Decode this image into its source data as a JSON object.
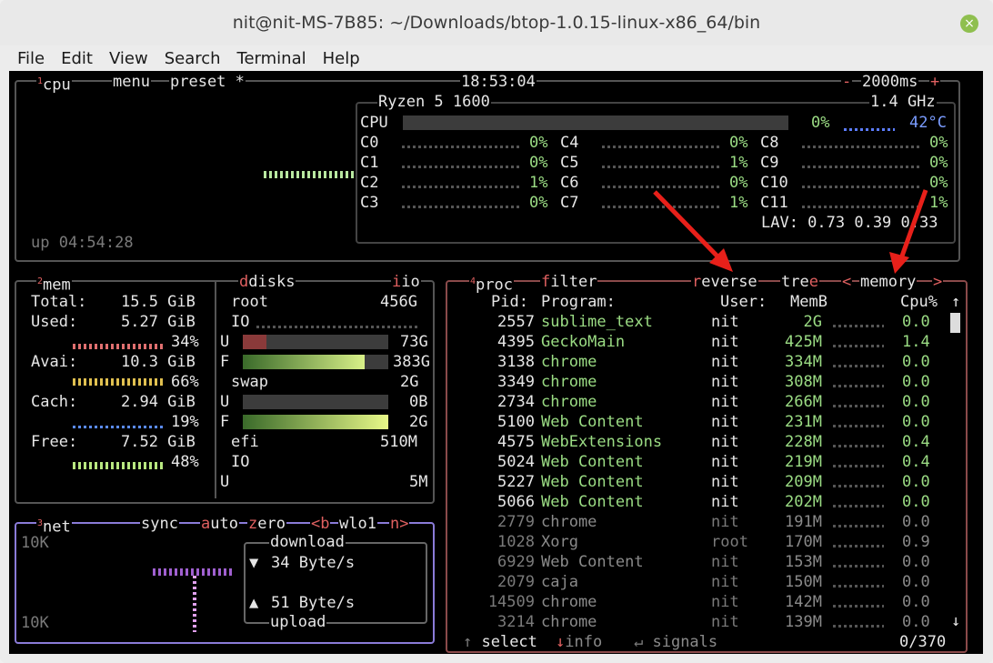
{
  "window": {
    "title": "nit@nit-MS-7B85: ~/Downloads/btop-1.0.15-linux-x86_64/bin",
    "close_label": "×"
  },
  "menu": [
    "File",
    "Edit",
    "View",
    "Search",
    "Terminal",
    "Help"
  ],
  "cpu_box": {
    "num": "1",
    "label": "cpu",
    "menu": "menu",
    "preset": "preset *",
    "clock": "18:53:04",
    "interval": "2000ms",
    "minus": "-",
    "plus": "+",
    "uptime": "up 04:54:28"
  },
  "cpu_info": {
    "model": "Ryzen 5 1600",
    "freq": "1.4 GHz",
    "total_label": "CPU",
    "total_pct": "0%",
    "temp": "42°C",
    "lav": "LAV: 0.73 0.39 0.33",
    "cores": [
      {
        "name": "C0",
        "pct": "0%"
      },
      {
        "name": "C1",
        "pct": "0%"
      },
      {
        "name": "C2",
        "pct": "1%"
      },
      {
        "name": "C3",
        "pct": "0%"
      },
      {
        "name": "C4",
        "pct": "0%"
      },
      {
        "name": "C5",
        "pct": "1%"
      },
      {
        "name": "C6",
        "pct": "0%"
      },
      {
        "name": "C7",
        "pct": "1%"
      },
      {
        "name": "C8",
        "pct": "0%"
      },
      {
        "name": "C9",
        "pct": "0%"
      },
      {
        "name": "C10",
        "pct": "0%"
      },
      {
        "name": "C11",
        "pct": "1%"
      }
    ]
  },
  "mem_box": {
    "num": "2",
    "label": "mem",
    "total": {
      "label": "Total:",
      "value": "15.5 GiB"
    },
    "used": {
      "label": "Used:",
      "value": "5.27 GiB",
      "pct": "34%"
    },
    "avail": {
      "label": "Avai:",
      "value": "10.3 GiB",
      "pct": "66%"
    },
    "cache": {
      "label": "Cach:",
      "value": "2.94 GiB",
      "pct": "19%"
    },
    "free": {
      "label": "Free:",
      "value": "7.52 GiB",
      "pct": "48%"
    }
  },
  "disks_box": {
    "label": "disks",
    "io": "io",
    "root": {
      "name": "root",
      "size": "456G",
      "io": "IO",
      "u": "U",
      "u_val": "73G",
      "f": "F",
      "f_val": "383G",
      "u_frac": 0.16,
      "f_frac": 0.84
    },
    "swap": {
      "name": "swap",
      "size": "2G",
      "u": "U",
      "u_val": "0B",
      "f": "F",
      "f_val": "2G",
      "u_frac": 0.0,
      "f_frac": 1.0
    },
    "efi": {
      "name": "efi",
      "size": "510M",
      "io": "IO",
      "u": "U",
      "u_val": "5M"
    }
  },
  "net_box": {
    "num": "3",
    "label": "net",
    "sync": "sync",
    "auto": "auto",
    "zero": "zero",
    "iface_prev": "<b",
    "iface": "wlo1",
    "iface_next": "n>",
    "scale_top": "10K",
    "scale_bottom": "10K",
    "download_label": "download",
    "download": "34 Byte/s",
    "upload": "51 Byte/s",
    "upload_label": "upload"
  },
  "proc_box": {
    "num": "4",
    "label": "proc",
    "filter": "filter",
    "reverse": "reverse",
    "tree": "tree",
    "sort": "memory",
    "sort_prev": "<",
    "sort_next": ">",
    "headers": {
      "pid": "Pid:",
      "program": "Program:",
      "user": "User:",
      "mem": "MemB",
      "cpu": "Cpu%"
    },
    "rows": [
      {
        "pid": "2557",
        "program": "sublime_text",
        "user": "nit",
        "mem": "2G",
        "cpu": "0.0"
      },
      {
        "pid": "4395",
        "program": "GeckoMain",
        "user": "nit",
        "mem": "425M",
        "cpu": "1.4"
      },
      {
        "pid": "3138",
        "program": "chrome",
        "user": "nit",
        "mem": "334M",
        "cpu": "0.0"
      },
      {
        "pid": "3349",
        "program": "chrome",
        "user": "nit",
        "mem": "308M",
        "cpu": "0.0"
      },
      {
        "pid": "2734",
        "program": "chrome",
        "user": "nit",
        "mem": "266M",
        "cpu": "0.0"
      },
      {
        "pid": "5100",
        "program": "Web Content",
        "user": "nit",
        "mem": "231M",
        "cpu": "0.0"
      },
      {
        "pid": "4575",
        "program": "WebExtensions",
        "user": "nit",
        "mem": "228M",
        "cpu": "0.4"
      },
      {
        "pid": "5024",
        "program": "Web Content",
        "user": "nit",
        "mem": "219M",
        "cpu": "0.4"
      },
      {
        "pid": "5227",
        "program": "Web Content",
        "user": "nit",
        "mem": "209M",
        "cpu": "0.0"
      },
      {
        "pid": "5066",
        "program": "Web Content",
        "user": "nit",
        "mem": "202M",
        "cpu": "0.0"
      },
      {
        "pid": "2779",
        "program": "chrome",
        "user": "nit",
        "mem": "191M",
        "cpu": "0.0"
      },
      {
        "pid": "1028",
        "program": "Xorg",
        "user": "root",
        "mem": "170M",
        "cpu": "0.9"
      },
      {
        "pid": "6929",
        "program": "Web Content",
        "user": "nit",
        "mem": "153M",
        "cpu": "0.0"
      },
      {
        "pid": "2079",
        "program": "caja",
        "user": "nit",
        "mem": "150M",
        "cpu": "0.0"
      },
      {
        "pid": "14509",
        "program": "chrome",
        "user": "nit",
        "mem": "142M",
        "cpu": "0.0"
      },
      {
        "pid": "3214",
        "program": "chrome",
        "user": "nit",
        "mem": "139M",
        "cpu": "0.0"
      }
    ],
    "footer": {
      "select": "select",
      "info": "info",
      "signals": "signals",
      "count": "0/370"
    }
  },
  "colors": {
    "accent_red": "#e06060",
    "green": "#9bdc84",
    "net_border": "#8a7bd8",
    "arrow": "#e8201a"
  }
}
